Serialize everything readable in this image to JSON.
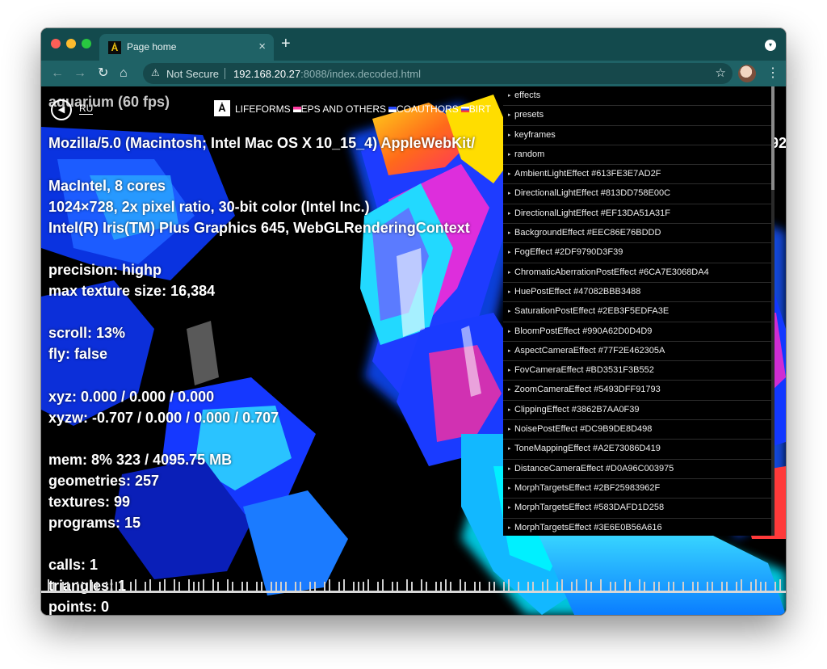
{
  "browser": {
    "tab": {
      "title": "Page home",
      "favicon": "Ȧ",
      "close": "×"
    },
    "new_tab": "+",
    "toolbar": {
      "back": "←",
      "forward": "→",
      "reload": "↻",
      "home": "⌂",
      "security_icon": "⚠",
      "security_text": "Not Secure",
      "url_host": "192.168.20.27",
      "url_rest": ":8088/index.decoded.html",
      "star": "☆",
      "menu": "⋮"
    },
    "window_menu": "▾"
  },
  "page": {
    "fps": "aquarium (60 fps)",
    "speaker": "◀",
    "lang": "RU",
    "logo": "Ȧ",
    "nav": {
      "lifeforms": "LIFEFORMS",
      "eps": "EPS AND OTHERS",
      "coauthors": "COAUTHORS",
      "birth": "BIRT"
    },
    "info_lines": [
      "Mozilla/5.0 (Macintosh; Intel Mac OS X 10_15_4) AppleWebKit/",
      "/92",
      "MacIntel, 8 cores",
      "1024×728, 2x pixel ratio, 30-bit color (Intel Inc.)",
      "Intel(R) Iris(TM) Plus Graphics 645, WebGLRenderingContext",
      "precision: highp",
      "max texture size: 16,384",
      "scroll: 13%",
      "fly: false",
      "xyz: 0.000 / 0.000 / 0.000",
      "xyzw: -0.707 / 0.000 / 0.000 / 0.707",
      "mem: 8% 323 / 4095.75 MB",
      "geometries: 257",
      "textures: 99",
      "programs: 15",
      "calls: 1",
      "triangles: 1",
      "points: 0"
    ],
    "gui_items": [
      "effects",
      "presets",
      "keyframes",
      "random",
      "AmbientLightEffect #613FE3E7AD2F",
      "DirectionalLightEffect #813DD758E00C",
      "DirectionalLightEffect #EF13DA51A31F",
      "BackgroundEffect #EEC86E76BDDD",
      "FogEffect #2DF9790D3F39",
      "ChromaticAberrationPostEffect #6CA7E3068DA4",
      "HuePostEffect #47082BBB3488",
      "SaturationPostEffect #2EB3F5EDFA3E",
      "BloomPostEffect #990A62D0D4D9",
      "AspectCameraEffect #77F2E462305A",
      "FovCameraEffect #BD3531F3B552",
      "ZoomCameraEffect #5493DFF91793",
      "ClippingEffect #3862B7AA0F39",
      "NoisePostEffect #DC9B9DE8D498",
      "ToneMappingEffect #A2E73086D419",
      "DistanceCameraEffect #D0A96C003975",
      "MorphTargetsEffect #2BF25983962F",
      "MorphTargetsEffect #583DAFD1D258",
      "MorphTargetsEffect #3E6E0B56A616"
    ],
    "gui_arrow": "▸"
  }
}
